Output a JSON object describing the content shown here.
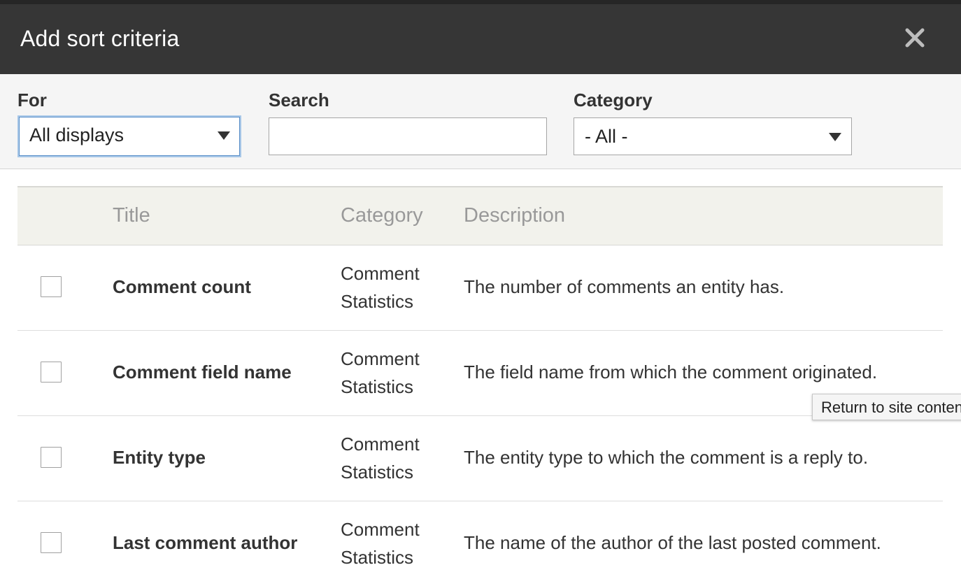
{
  "dialog": {
    "title": "Add sort criteria",
    "close_icon": "close-icon"
  },
  "filters": {
    "for": {
      "label": "For",
      "value": "All displays"
    },
    "search": {
      "label": "Search",
      "value": "",
      "placeholder": ""
    },
    "category": {
      "label": "Category",
      "value": "- All -"
    }
  },
  "table": {
    "headers": [
      "",
      "Title",
      "Category",
      "Description"
    ],
    "rows": [
      {
        "checked": false,
        "title": "Comment count",
        "category": [
          "Comment",
          "Statistics"
        ],
        "description": "The number of comments an entity has."
      },
      {
        "checked": false,
        "title": "Comment field name",
        "category": [
          "Comment",
          "Statistics"
        ],
        "description": "The field name from which the comment originated."
      },
      {
        "checked": false,
        "title": "Entity type",
        "category": [
          "Comment",
          "Statistics"
        ],
        "description": "The entity type to which the comment is a reply to."
      },
      {
        "checked": false,
        "title": "Last comment author",
        "category": [
          "Comment",
          "Statistics"
        ],
        "description": "The name of the author of the last posted comment."
      }
    ]
  },
  "tooltip": {
    "text": "Return to site content"
  },
  "colors": {
    "titlebar": "#363636",
    "filter_bg": "#f5f5f5",
    "table_header_bg": "#f2f2ec",
    "focus_ring": "#5a8fc8"
  }
}
